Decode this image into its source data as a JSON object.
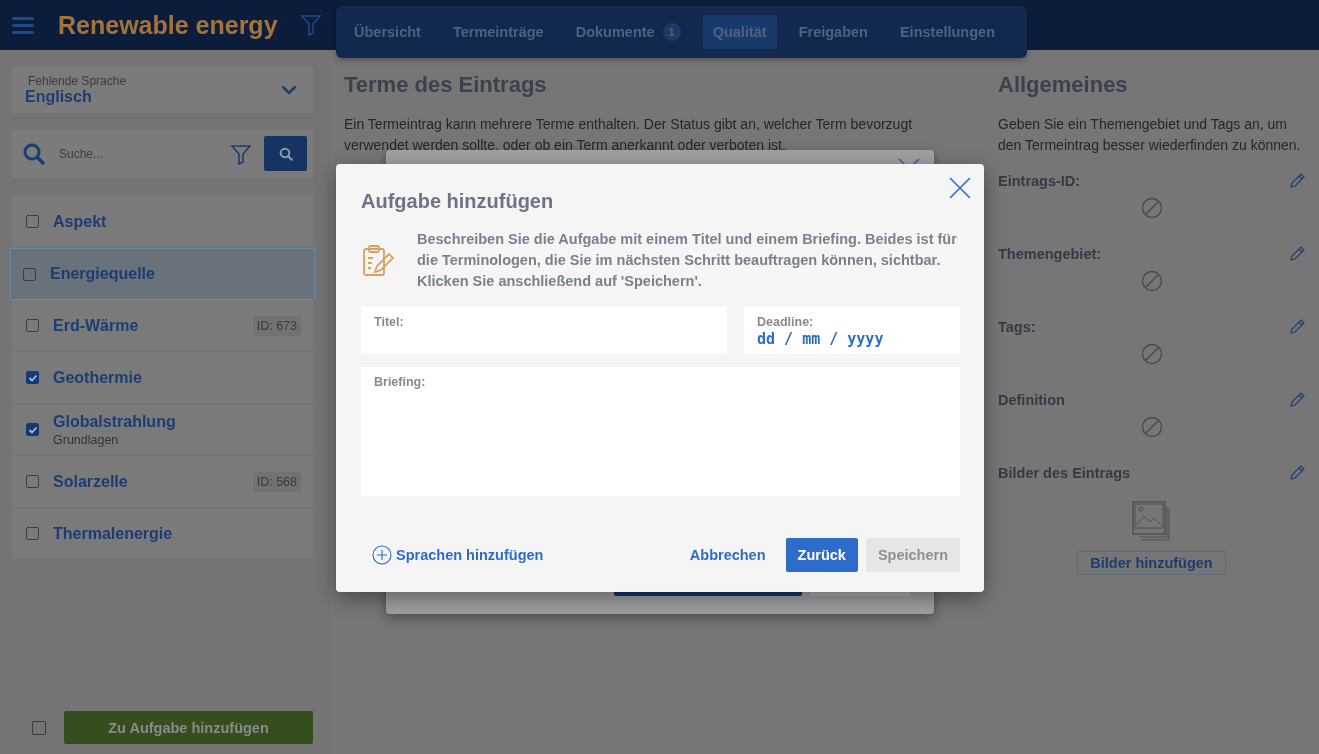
{
  "header": {
    "title": "Renewable energy"
  },
  "tabs": [
    {
      "label": "Übersicht",
      "selected": false
    },
    {
      "label": "Termeinträge",
      "selected": false
    },
    {
      "label": "Dokumente",
      "selected": false,
      "badge": "1"
    },
    {
      "label": "Qualität",
      "selected": true
    },
    {
      "label": "Freigaben",
      "selected": false
    },
    {
      "label": "Einstellungen",
      "selected": false
    }
  ],
  "sidebar": {
    "language_select": {
      "label": "Fehlende Sprache",
      "value": "Englisch"
    },
    "search": {
      "placeholder": "Suche..."
    },
    "items": [
      {
        "label": "Aspekt",
        "checked": false,
        "selected": false
      },
      {
        "label": "Energiequelle",
        "checked": false,
        "selected": true
      },
      {
        "label": "Erd-Wärme",
        "checked": false,
        "selected": false,
        "id_badge": "ID: 673"
      },
      {
        "label": "Geothermie",
        "checked": true,
        "selected": false
      },
      {
        "label": "Globalstrahlung",
        "checked": true,
        "selected": false,
        "subtitle": "Grundlagen"
      },
      {
        "label": "Solarzelle",
        "checked": false,
        "selected": false,
        "id_badge": "ID: 568"
      },
      {
        "label": "Thermalenergie",
        "checked": false,
        "selected": false
      }
    ],
    "footer": {
      "checked": false,
      "button": "Zu Aufgabe hinzufügen"
    }
  },
  "terms_section": {
    "title": "Terme des Eintrags",
    "description": "Ein Termeintrag kann mehrere Terme enthalten. Der Status gibt an, welcher Term bevorzugt verwendet werden sollte, oder ob ein Term anerkannt oder verboten ist."
  },
  "general": {
    "title": "Allgemeines",
    "description": "Geben Sie ein Themengebiet und Tags an, um den Termeintrag besser wiederfinden zu können.",
    "fields": [
      {
        "label": "Eintrags-ID:",
        "kind": "empty"
      },
      {
        "label": "Themengebiet:",
        "kind": "empty"
      },
      {
        "label": "Tags:",
        "kind": "empty"
      },
      {
        "label": "Definition",
        "kind": "empty"
      },
      {
        "label": "Bilder des Eintrags",
        "kind": "images",
        "button": "Bilder hinzufügen"
      }
    ]
  },
  "dialog": {
    "title": "Aufgabe hinzufügen",
    "description": "Beschreiben Sie die Aufgabe mit einem Titel und einem Briefing. Beides ist für die Terminologen, die Sie im nächsten Schritt beauftragen können, sichtbar. Klicken Sie anschließend auf 'Speichern'.",
    "title_field": {
      "label": "Titel:"
    },
    "deadline_field": {
      "label": "Deadline:",
      "placeholder": "dd / mm / yyyy"
    },
    "briefing_field": {
      "label": "Briefing:"
    },
    "add_languages": "Sprachen hinzufügen",
    "buttons": [
      {
        "label": "Abbrechen",
        "kind": "link",
        "disabled": false
      },
      {
        "label": "Zurück",
        "kind": "primary",
        "disabled": false
      },
      {
        "label": "Speichern",
        "kind": "primary",
        "disabled": true
      }
    ]
  }
}
